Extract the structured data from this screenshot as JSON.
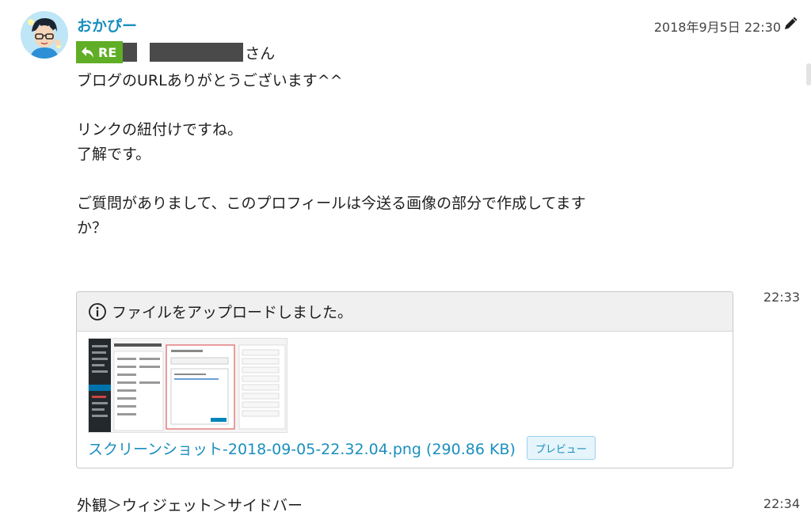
{
  "message1": {
    "sender": "おかぴー",
    "timestamp": "2018年9月5日 22:30",
    "re_label": "RE",
    "recipient_suffix": "さん",
    "body": "ブログのURLありがとうございます^^\n\nリンクの紐付けですね。\n了解です。\n\nご質問がありまして、このプロフィールは今送る画像の部分で作成してます\nか？"
  },
  "message2": {
    "time": "22:33",
    "notice": "ファイルをアップロードしました。",
    "file_name": "スクリーンショット-2018-09-05-22.32.04.png",
    "file_size": "(290.86 KB)",
    "preview_label": "プレビュー"
  },
  "message3": {
    "time": "22:34",
    "body": "外観＞ウィジェット＞サイドバー"
  },
  "colors": {
    "accent": "#1a8fbd",
    "re_badge": "#5fae25",
    "redaction": "#4a4a4a"
  },
  "icons": {
    "edit": "pencil-icon",
    "reply": "reply-arrow-icon",
    "info": "info-circle-icon"
  }
}
